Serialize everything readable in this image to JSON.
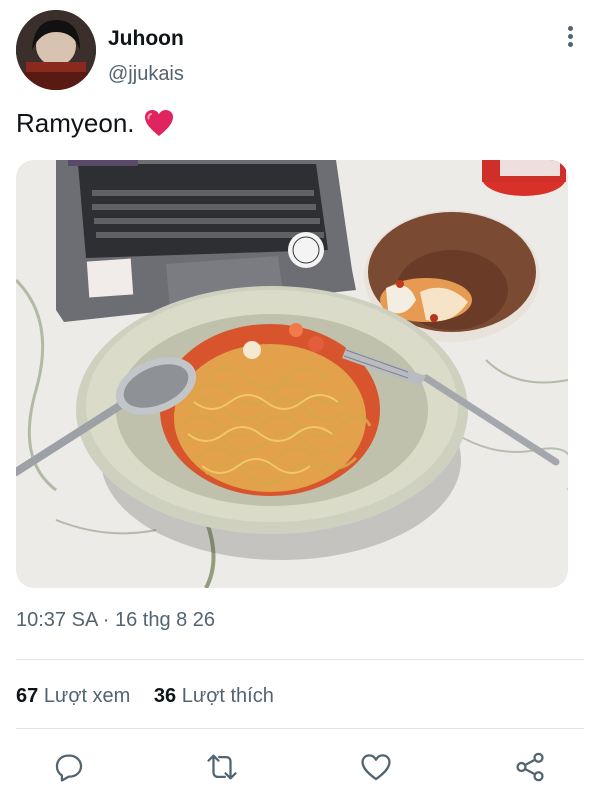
{
  "user": {
    "display_name": "Juhoon",
    "handle": "@jjukais",
    "avatar_icon": "avatar"
  },
  "tweet": {
    "text": "Ramyeon.",
    "emoji": "❤️",
    "timestamp": "10:37 SA · 16 thg 8 26"
  },
  "stats": {
    "views_count": "67",
    "views_label": "Lượt xem",
    "likes_count": "36",
    "likes_label": "Lượt thích"
  },
  "actions": [
    "reply-icon",
    "retweet-icon",
    "like-icon",
    "share-icon"
  ],
  "colors": {
    "text": "#0f1419",
    "secondary": "#536471",
    "heart": "#e0245e"
  }
}
